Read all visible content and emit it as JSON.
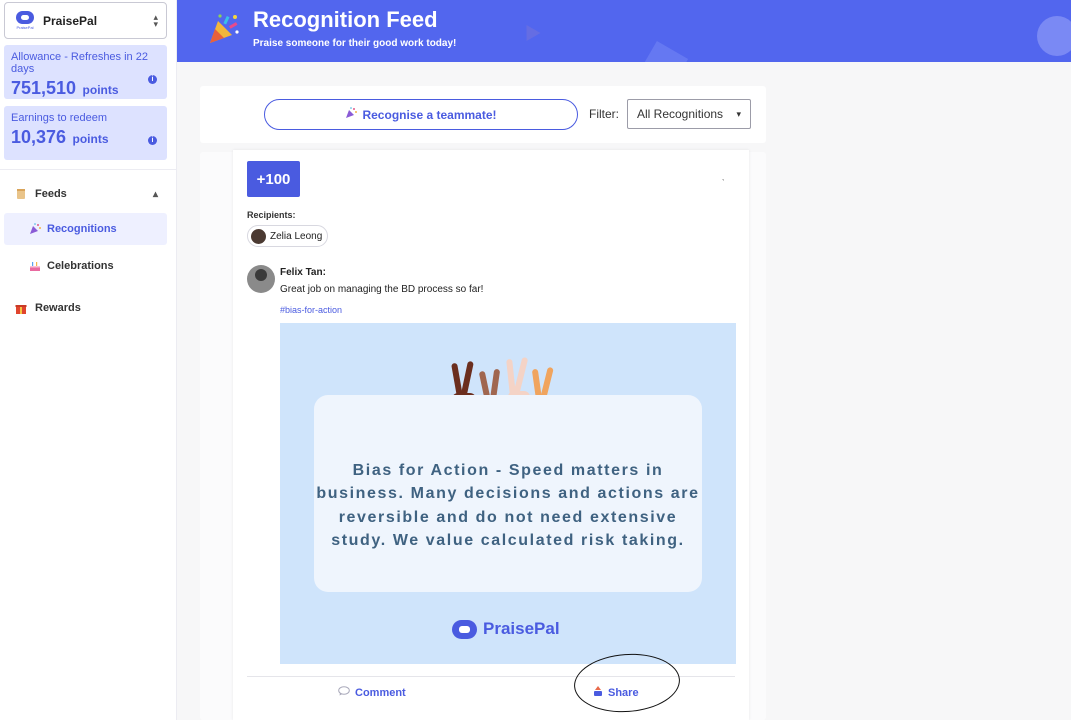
{
  "sidebar": {
    "org_name": "PraisePal",
    "org_logo_tiny": "PraisePal",
    "allowance": {
      "label": "Allowance - Refreshes in 22 days",
      "value": "751,510",
      "unit": "points"
    },
    "earnings": {
      "label": "Earnings to redeem",
      "value": "10,376",
      "unit": "points"
    },
    "nav": {
      "feeds": "Feeds",
      "recognitions": "Recognitions",
      "celebrations": "Celebrations",
      "rewards": "Rewards"
    }
  },
  "header": {
    "title": "Recognition Feed",
    "subtitle": "Praise someone for their good work today!"
  },
  "toolbar": {
    "recognise_button": "Recognise a teammate!",
    "filter_label": "Filter:",
    "filter_value": "All Recognitions"
  },
  "post": {
    "points": "+100",
    "more": "ˎ",
    "recipients_label": "Recipients:",
    "recipients": [
      "Zelia Leong"
    ],
    "author": "Felix Tan:",
    "message": "Great job on managing the BD process so far!",
    "tag": "#bias-for-action",
    "image": {
      "quote": "Bias for Action - Speed matters in business. Many decisions and actions are reversible and do not need extensive study. We value calculated risk taking.",
      "brand": "PraisePal"
    },
    "actions": {
      "comment": "Comment",
      "share": "Share"
    }
  },
  "colors": {
    "brand": "#4a5be0",
    "header_bg": "#5266ee",
    "image_bg": "#cfe4fb"
  }
}
